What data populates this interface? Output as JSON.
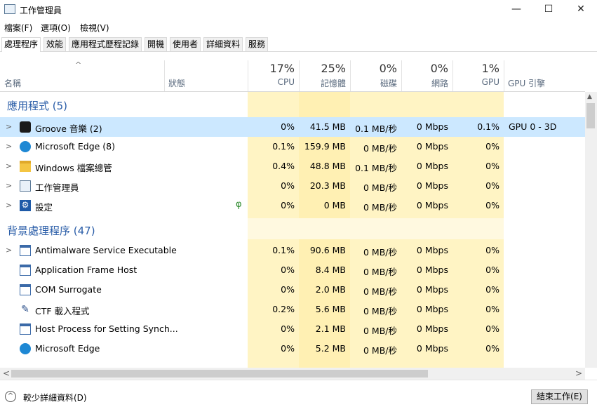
{
  "window": {
    "title": "工作管理員",
    "min_icon": "minimize-icon",
    "max_icon": "maximize-icon",
    "close_icon": "close-icon"
  },
  "menu": [
    "檔案(F)",
    "選項(O)",
    "檢視(V)"
  ],
  "tabs": [
    "處理程序",
    "效能",
    "應用程式歷程記錄",
    "開機",
    "使用者",
    "詳細資料",
    "服務"
  ],
  "columns": {
    "name": "名稱",
    "status": "狀態",
    "cpu": {
      "pct": "17%",
      "label": "CPU"
    },
    "mem": {
      "pct": "25%",
      "label": "記憶體"
    },
    "disk": {
      "pct": "0%",
      "label": "磁碟"
    },
    "net": {
      "pct": "0%",
      "label": "網路"
    },
    "gpu": {
      "pct": "1%",
      "label": "GPU"
    },
    "gpueng": "GPU 引擎"
  },
  "groups": {
    "apps": "應用程式 (5)",
    "background": "背景處理程序 (47)"
  },
  "apps": [
    {
      "name": "Groove 音樂 (2)",
      "cpu": "0%",
      "mem": "41.5 MB",
      "disk": "0.1 MB/秒",
      "net": "0 Mbps",
      "gpu": "0.1%",
      "gpueng": "GPU 0 - 3D",
      "icon": "groove-music-icon"
    },
    {
      "name": "Microsoft Edge (8)",
      "cpu": "0.1%",
      "mem": "159.9 MB",
      "disk": "0 MB/秒",
      "net": "0 Mbps",
      "gpu": "0%",
      "gpueng": "",
      "icon": "edge-icon"
    },
    {
      "name": "Windows 檔案總管",
      "cpu": "0.4%",
      "mem": "48.8 MB",
      "disk": "0.1 MB/秒",
      "net": "0 Mbps",
      "gpu": "0%",
      "gpueng": "",
      "icon": "file-explorer-icon"
    },
    {
      "name": "工作管理員",
      "cpu": "0%",
      "mem": "20.3 MB",
      "disk": "0 MB/秒",
      "net": "0 Mbps",
      "gpu": "0%",
      "gpueng": "",
      "icon": "task-manager-icon"
    },
    {
      "name": "設定",
      "cpu": "0%",
      "mem": "0 MB",
      "disk": "0 MB/秒",
      "net": "0 Mbps",
      "gpu": "0%",
      "gpueng": "",
      "icon": "settings-gear-icon",
      "status_icon": "suspended-leaf-icon"
    }
  ],
  "background": [
    {
      "name": "Antimalware Service Executable",
      "cpu": "0.1%",
      "mem": "90.6 MB",
      "disk": "0 MB/秒",
      "net": "0 Mbps",
      "gpu": "0%",
      "icon": "service-window-icon",
      "expand": true
    },
    {
      "name": "Application Frame Host",
      "cpu": "0%",
      "mem": "8.4 MB",
      "disk": "0 MB/秒",
      "net": "0 Mbps",
      "gpu": "0%",
      "icon": "service-window-icon"
    },
    {
      "name": "COM Surrogate",
      "cpu": "0%",
      "mem": "2.0 MB",
      "disk": "0 MB/秒",
      "net": "0 Mbps",
      "gpu": "0%",
      "icon": "service-window-icon"
    },
    {
      "name": "CTF 載入程式",
      "cpu": "0.2%",
      "mem": "5.6 MB",
      "disk": "0 MB/秒",
      "net": "0 Mbps",
      "gpu": "0%",
      "icon": "ctf-pen-icon"
    },
    {
      "name": "Host Process for Setting Synch...",
      "cpu": "0%",
      "mem": "2.1 MB",
      "disk": "0 MB/秒",
      "net": "0 Mbps",
      "gpu": "0%",
      "icon": "service-window-icon"
    },
    {
      "name": "Microsoft Edge",
      "cpu": "0%",
      "mem": "5.2 MB",
      "disk": "0 MB/秒",
      "net": "0 Mbps",
      "gpu": "0%",
      "icon": "edge-icon"
    }
  ],
  "footer": {
    "less_details": "較少詳細資料(D)",
    "end_task": "結束工作(E)"
  },
  "colors": {
    "cpu_bg": "#fff4c4",
    "mem_bg": "#fff0b3",
    "light_bg": "#fff9e0",
    "selected_row": "#cce8ff",
    "group_text": "#2a5da8"
  }
}
